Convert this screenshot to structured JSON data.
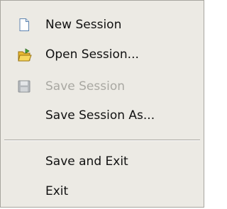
{
  "menu": {
    "items": [
      {
        "label": "New Session",
        "icon": "new-document-icon",
        "enabled": true
      },
      {
        "label": "Open Session...",
        "icon": "open-folder-icon",
        "enabled": true
      },
      {
        "label": "Save Session",
        "icon": "save-disk-icon",
        "enabled": false
      },
      {
        "label": "Save Session As...",
        "icon": "",
        "enabled": true
      },
      {
        "label": "Save and Exit",
        "icon": "",
        "enabled": true
      },
      {
        "label": "Exit",
        "icon": "",
        "enabled": true
      }
    ]
  },
  "colors": {
    "menu_background": "#eceae4",
    "text": "#111111",
    "disabled_text": "#a9a8a2"
  }
}
